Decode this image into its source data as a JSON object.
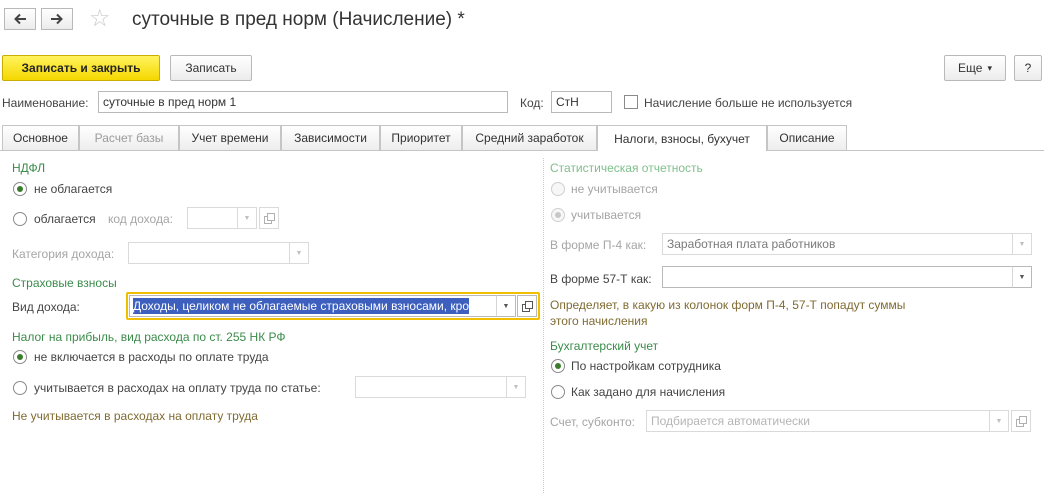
{
  "header": {
    "back_icon": "arrow-left-icon",
    "forward_icon": "arrow-right-icon",
    "favorite_icon": "star-icon",
    "star_glyph": "☆",
    "title": "суточные в пред норм (Начисление) *"
  },
  "toolbar": {
    "save_close_label": "Записать и закрыть",
    "save_label": "Записать",
    "more_label": "Еще",
    "more_arrow": "▾",
    "help_label": "?"
  },
  "top_fields": {
    "name_label": "Наименование:",
    "name_value": "суточные в пред норм 1",
    "code_label": "Код:",
    "code_value": "СтН",
    "unused_checkbox_label": "Начисление больше не используется",
    "unused_checked": false
  },
  "tabs": [
    {
      "label": "Основное",
      "disabled": false
    },
    {
      "label": "Расчет базы",
      "disabled": true
    },
    {
      "label": "Учет времени",
      "disabled": false
    },
    {
      "label": "Зависимости",
      "disabled": false
    },
    {
      "label": "Приоритет",
      "disabled": false
    },
    {
      "label": "Средний заработок",
      "disabled": false
    },
    {
      "label": "Налоги, взносы, бухучет",
      "disabled": false,
      "active": true
    },
    {
      "label": "Описание",
      "disabled": false
    }
  ],
  "left": {
    "ndfl": {
      "title": "НДФЛ",
      "option_not_taxed": "не облагается",
      "option_taxed": "облагается",
      "income_code_label": "код дохода:",
      "income_code_value": "",
      "category_label": "Категория дохода:",
      "category_value": ""
    },
    "insurance": {
      "title": "Страховые взносы",
      "income_type_label": "Вид дохода:",
      "income_type_value": "Доходы, целиком не облагаемые страховыми взносами, кро"
    },
    "profit_tax": {
      "title": "Налог на прибыль, вид расхода по ст. 255 НК РФ",
      "option_not_included": "не включается в расходы по оплате труда",
      "option_included": "учитывается в расходах на оплату труда по статье:",
      "article_value": "",
      "note": "Не учитывается в расходах на оплату труда"
    }
  },
  "right": {
    "stats": {
      "title": "Статистическая отчетность",
      "option_not_counted": "не учитывается",
      "option_counted": "учитывается",
      "p4_label": "В форме П-4 как:",
      "p4_value": "Заработная плата работников",
      "f57_label": "В форме 57-Т как:",
      "f57_value": "",
      "note_line1": "Определяет, в какую из колонок форм П-4, 57-Т попадут суммы",
      "note_line2": "этого начисления"
    },
    "accounting": {
      "title": "Бухгалтерский учет",
      "option_by_employee": "По настройкам сотрудника",
      "option_as_set": "Как задано для начисления",
      "account_label": "Счет, субконто:",
      "account_placeholder": "Подбирается автоматически"
    }
  },
  "icons": {
    "dropdown_glyph": "▼",
    "open_icon": "open-form-icon"
  },
  "colors": {
    "accent_green": "#3b8b4a",
    "primary_button": "#f5d800",
    "focus_frame": "#f0c000",
    "selection": "#3d5fbd",
    "note_text": "#7f6b32"
  }
}
